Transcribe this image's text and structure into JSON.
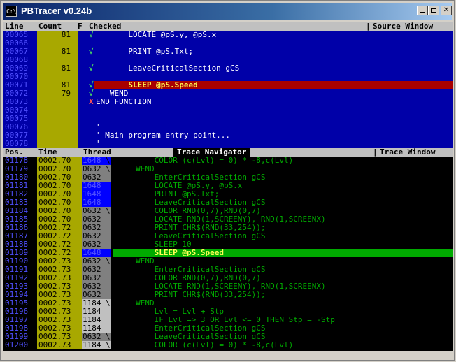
{
  "window": {
    "title": "PBTracer v0.24b",
    "icon_label": "C:\\",
    "buttons": {
      "minimize": "minimize-icon",
      "maximize": "maximize-icon",
      "close": "✕"
    }
  },
  "colors": {
    "source_bg": "#0000a8",
    "count_bg": "#a8a800",
    "highlight_source": "#a80000",
    "highlight_trace": "#00aa00",
    "thread_blue": "#0000ff",
    "thread_gray": "#808080",
    "thread_light": "#c0c0c0"
  },
  "source_header": {
    "line": "Line",
    "count": "Count",
    "f": "F",
    "checked": "Checked",
    "window_label": "Source Window"
  },
  "source_rows": [
    {
      "line": "00065",
      "count": "81",
      "check": "√",
      "code": "       LOCATE @pS.y, @pS.x"
    },
    {
      "line": "00066",
      "count": "",
      "check": "",
      "code": ""
    },
    {
      "line": "00067",
      "count": "81",
      "check": "√",
      "code": "       PRINT @pS.Txt;"
    },
    {
      "line": "00068",
      "count": "",
      "check": "",
      "code": ""
    },
    {
      "line": "00069",
      "count": "81",
      "check": "√",
      "code": "       LeaveCriticalSection gCS"
    },
    {
      "line": "00070",
      "count": "",
      "check": "",
      "code": ""
    },
    {
      "line": "00071",
      "count": "81",
      "check": "√",
      "code": "       SLEEP @pS.Speed",
      "highlight": true
    },
    {
      "line": "00072",
      "count": "79",
      "check": "√",
      "code": "   WEND"
    },
    {
      "line": "00073",
      "count": "",
      "check": "X",
      "code": "END FUNCTION"
    },
    {
      "line": "00074",
      "count": "",
      "check": "",
      "code": ""
    },
    {
      "line": "00075",
      "count": "",
      "check": "",
      "code": ""
    },
    {
      "line": "00076",
      "count": "",
      "check": "",
      "code": "' ______________________________________________________________"
    },
    {
      "line": "00077",
      "count": "",
      "check": "",
      "code": "' Main program entry point..."
    },
    {
      "line": "00078",
      "count": "",
      "check": "",
      "code": "'"
    }
  ],
  "trace_header": {
    "pos": "Pos.",
    "time": "Time",
    "thread": "Thread",
    "navigator": "Trace Navigator",
    "window_label": "Trace Window"
  },
  "trace_rows": [
    {
      "pos": "01178",
      "time": "0002.70",
      "thread": "1648",
      "mark": "\\",
      "tc": "blue",
      "code": "         COLOR (c(Lvl) = 0) * -8,c(Lvl)"
    },
    {
      "pos": "01179",
      "time": "0002.70",
      "thread": "0632",
      "mark": "\\",
      "tc": "gray",
      "code": "     WEND"
    },
    {
      "pos": "01180",
      "time": "0002.70",
      "thread": "0632",
      "mark": "",
      "tc": "gray",
      "code": "         EnterCriticalSection gCS"
    },
    {
      "pos": "01181",
      "time": "0002.70",
      "thread": "1648",
      "mark": "",
      "tc": "blue",
      "code": "         LOCATE @pS.y, @pS.x"
    },
    {
      "pos": "01182",
      "time": "0002.70",
      "thread": "1648",
      "mark": "",
      "tc": "blue",
      "code": "         PRINT @pS.Txt;"
    },
    {
      "pos": "01183",
      "time": "0002.70",
      "thread": "1648",
      "mark": "",
      "tc": "blue",
      "code": "         LeaveCriticalSection gCS"
    },
    {
      "pos": "01184",
      "time": "0002.70",
      "thread": "0632",
      "mark": "\\",
      "tc": "gray",
      "code": "         COLOR RND(0,7),RND(0,7)"
    },
    {
      "pos": "01185",
      "time": "0002.70",
      "thread": "0632",
      "mark": "",
      "tc": "gray",
      "code": "         LOCATE RND(1,SCREENY), RND(1,SCREENX)"
    },
    {
      "pos": "01186",
      "time": "0002.72",
      "thread": "0632",
      "mark": "",
      "tc": "gray",
      "code": "         PRINT CHR$(RND(33,254));"
    },
    {
      "pos": "01187",
      "time": "0002.72",
      "thread": "0632",
      "mark": "",
      "tc": "gray",
      "code": "         LeaveCriticalSection gCS"
    },
    {
      "pos": "01188",
      "time": "0002.72",
      "thread": "0632",
      "mark": "",
      "tc": "gray",
      "code": "         SLEEP 10"
    },
    {
      "pos": "01189",
      "time": "0002.72",
      "thread": "1648",
      "mark": "",
      "tc": "blue",
      "code": "         SLEEP @pS.Speed",
      "highlight": true
    },
    {
      "pos": "01190",
      "time": "0002.73",
      "thread": "0632",
      "mark": "\\",
      "tc": "gray",
      "code": "     WEND"
    },
    {
      "pos": "01191",
      "time": "0002.73",
      "thread": "0632",
      "mark": "",
      "tc": "gray",
      "code": "         EnterCriticalSection gCS"
    },
    {
      "pos": "01192",
      "time": "0002.73",
      "thread": "0632",
      "mark": "",
      "tc": "gray",
      "code": "         COLOR RND(0,7),RND(0,7)"
    },
    {
      "pos": "01193",
      "time": "0002.73",
      "thread": "0632",
      "mark": "",
      "tc": "gray",
      "code": "         LOCATE RND(1,SCREENY), RND(1,SCREENX)"
    },
    {
      "pos": "01194",
      "time": "0002.73",
      "thread": "0632",
      "mark": "",
      "tc": "gray",
      "code": "         PRINT CHR$(RND(33,254));"
    },
    {
      "pos": "01195",
      "time": "0002.73",
      "thread": "1184",
      "mark": "\\",
      "tc": "light",
      "code": "     WEND"
    },
    {
      "pos": "01196",
      "time": "0002.73",
      "thread": "1184",
      "mark": "",
      "tc": "light",
      "code": "         Lvl = Lvl + Stp"
    },
    {
      "pos": "01197",
      "time": "0002.73",
      "thread": "1184",
      "mark": "",
      "tc": "light",
      "code": "         IF Lvl => 3 OR Lvl <= 0 THEN Stp = -Stp"
    },
    {
      "pos": "01198",
      "time": "0002.73",
      "thread": "1184",
      "mark": "",
      "tc": "light",
      "code": "         EnterCriticalSection gCS"
    },
    {
      "pos": "01199",
      "time": "0002.73",
      "thread": "0632",
      "mark": "\\",
      "tc": "gray",
      "code": "         LeaveCriticalSection gCS"
    },
    {
      "pos": "01200",
      "time": "0002.73",
      "thread": "1184",
      "mark": "\\",
      "tc": "light",
      "code": "         COLOR (c(Lvl) = 0) * -8,c(Lvl)"
    }
  ]
}
